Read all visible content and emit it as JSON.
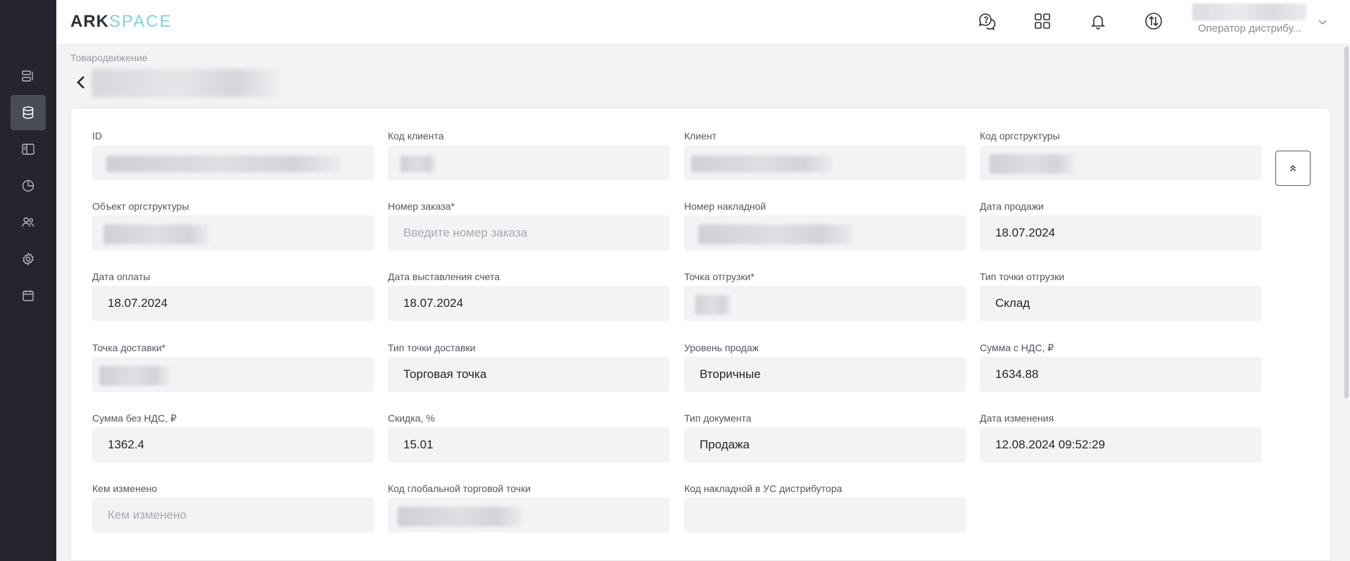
{
  "app": {
    "logo_part1": "ARK",
    "logo_part2": "SPACE",
    "user_role": "Оператор дистрибу...",
    "accent_color": "#7fd3dc"
  },
  "sidebar": {
    "items": [
      {
        "icon": "list-icon",
        "active": false
      },
      {
        "icon": "database-icon",
        "active": true
      },
      {
        "icon": "layout-icon",
        "active": false
      },
      {
        "icon": "pie-chart-icon",
        "active": false
      },
      {
        "icon": "users-icon",
        "active": false
      },
      {
        "icon": "gear-icon",
        "active": false
      },
      {
        "icon": "calendar-icon",
        "active": false
      }
    ]
  },
  "topbar": {
    "icons": [
      "support-chat-icon",
      "apps-grid-icon",
      "bell-icon",
      "sync-icon",
      "chevron-down-icon"
    ]
  },
  "page": {
    "breadcrumb": "Товародвижение"
  },
  "fields": [
    {
      "label": "ID",
      "value": "",
      "redacted": true
    },
    {
      "label": "Код клиента",
      "value": "",
      "redacted": true
    },
    {
      "label": "Клиент",
      "value": "",
      "redacted": true
    },
    {
      "label": "Код оргструктуры",
      "value": "",
      "redacted": true
    },
    {
      "label": "Объект оргструктуры",
      "value": "",
      "redacted": true
    },
    {
      "label": "Номер заказа*",
      "value": "",
      "placeholder": "Введите номер заказа"
    },
    {
      "label": "Номер накладной",
      "value": "",
      "redacted": true
    },
    {
      "label": "Дата продажи",
      "value": "18.07.2024"
    },
    {
      "label": "Дата оплаты",
      "value": "18.07.2024"
    },
    {
      "label": "Дата выставления счета",
      "value": "18.07.2024"
    },
    {
      "label": "Точка отгрузки*",
      "value": "",
      "redacted": true
    },
    {
      "label": "Тип точки отгрузки",
      "value": "Склад"
    },
    {
      "label": "Точка доставки*",
      "value": "",
      "redacted": true
    },
    {
      "label": "Тип точки доставки",
      "value": "Торговая точка"
    },
    {
      "label": "Уровень продаж",
      "value": "Вторичные"
    },
    {
      "label": "Сумма с НДС, ₽",
      "value": "1634.88"
    },
    {
      "label": "Сумма без НДС, ₽",
      "value": "1362.4"
    },
    {
      "label": "Скидка, %",
      "value": "15.01"
    },
    {
      "label": "Тип документа",
      "value": "Продажа"
    },
    {
      "label": "Дата изменения",
      "value": "12.08.2024 09:52:29"
    },
    {
      "label": "Кем изменено",
      "value": "",
      "placeholder": "Кем изменено"
    },
    {
      "label": "Код глобальной торговой точки",
      "value": "",
      "redacted": true
    },
    {
      "label": "Код накладной в УС дистрибутора",
      "value": ""
    }
  ]
}
